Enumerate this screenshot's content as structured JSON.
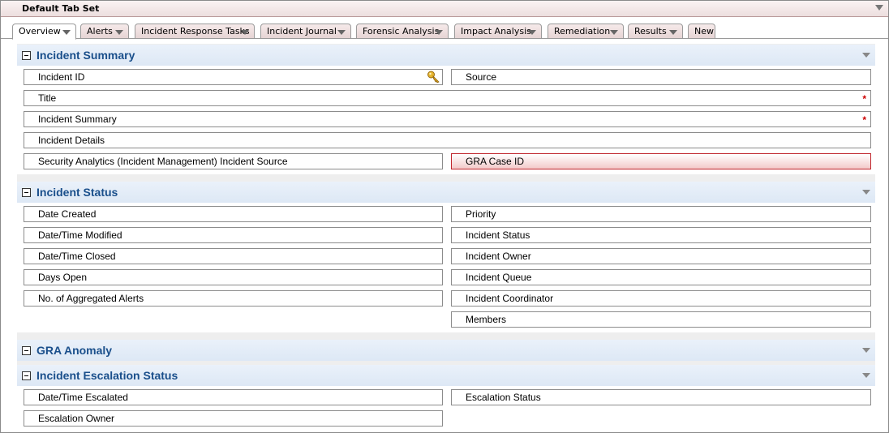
{
  "tabset": {
    "title": "Default Tab Set"
  },
  "tabs": [
    {
      "label": "Overview"
    },
    {
      "label": "Alerts"
    },
    {
      "label": "Incident Response Tasks"
    },
    {
      "label": "Incident Journal"
    },
    {
      "label": "Forensic Analysis"
    },
    {
      "label": "Impact Analysis"
    },
    {
      "label": "Remediation"
    },
    {
      "label": "Results"
    },
    {
      "label": "New"
    }
  ],
  "sections": {
    "summary": {
      "title": "Incident Summary",
      "fields": {
        "incident_id": "Incident ID",
        "source": "Source",
        "title": "Title",
        "incident_summary": "Incident Summary",
        "incident_details": "Incident Details",
        "sa_source": "Security Analytics (Incident Management) Incident Source",
        "gra_case_id": "GRA Case ID"
      },
      "required_marker": "*"
    },
    "status": {
      "title": "Incident Status",
      "fields": {
        "date_created": "Date Created",
        "priority": "Priority",
        "modified": "Date/Time Modified",
        "incident_status": "Incident Status",
        "closed": "Date/Time Closed",
        "owner": "Incident Owner",
        "days_open": "Days Open",
        "queue": "Incident Queue",
        "aggregated": "No. of Aggregated Alerts",
        "coordinator": "Incident Coordinator",
        "members": "Members"
      }
    },
    "gra": {
      "title": "GRA Anomaly"
    },
    "escalation": {
      "title": "Incident Escalation Status",
      "fields": {
        "escalated": "Date/Time Escalated",
        "escalation_status": "Escalation Status",
        "escalation_owner": "Escalation Owner"
      }
    }
  },
  "icons": {
    "key": "key-icon",
    "collapse": "collapse-icon",
    "dropdown": "dropdown-arrow-icon"
  },
  "colors": {
    "section_title": "#1a4f8b",
    "alert_border": "#c0262d",
    "required": "#cc0000"
  }
}
